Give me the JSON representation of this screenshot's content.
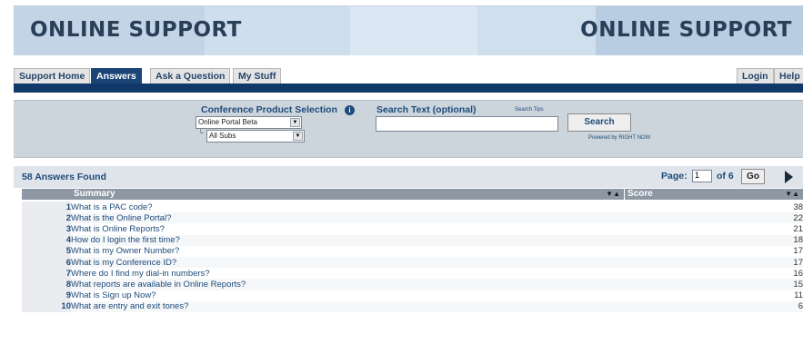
{
  "banner": {
    "title_left": "ONLINE SUPPORT",
    "title_right": "ONLINE SUPPORT"
  },
  "tabs": [
    {
      "label": "Support Home",
      "active": false
    },
    {
      "label": "Answers",
      "active": true
    },
    {
      "label": "Ask a Question",
      "active": false
    },
    {
      "label": "My Stuff",
      "active": false
    }
  ],
  "right_tabs": [
    {
      "label": "Login"
    },
    {
      "label": "Help"
    }
  ],
  "search": {
    "product_label": "Conference Product Selection",
    "product_value": "Online Portal Beta",
    "sub_value": "All Subs",
    "text_label": "Search Text (optional)",
    "tips_label": "Search Tips",
    "text_value": "",
    "button_label": "Search",
    "powered_by": "Powered by RIGHT NOW"
  },
  "results": {
    "found_label": "58 Answers Found",
    "page_label": "Page:",
    "page_value": "1",
    "page_of": "of 6",
    "go_label": "Go",
    "columns": {
      "summary": "Summary",
      "score": "Score"
    },
    "rows": [
      {
        "num": "1",
        "summary": "What is a PAC code?",
        "score": "38"
      },
      {
        "num": "2",
        "summary": "What is the Online Portal?",
        "score": "22"
      },
      {
        "num": "3",
        "summary": "What is Online Reports?",
        "score": "21"
      },
      {
        "num": "4",
        "summary": "How do I login the first time?",
        "score": "18"
      },
      {
        "num": "5",
        "summary": "What is my Owner Number?",
        "score": "17"
      },
      {
        "num": "6",
        "summary": "What is my Conference ID?",
        "score": "17"
      },
      {
        "num": "7",
        "summary": "Where do I find my dial-in numbers?",
        "score": "16"
      },
      {
        "num": "8",
        "summary": "What reports are available in Online Reports?",
        "score": "15"
      },
      {
        "num": "9",
        "summary": "What is Sign up Now?",
        "score": "11"
      },
      {
        "num": "10",
        "summary": "What are entry and exit tones?",
        "score": "6"
      }
    ]
  },
  "icons": {
    "info": "info-icon",
    "sort": "sort-arrows-icon",
    "next": "next-page-icon",
    "dropdown": "chevron-down-icon"
  }
}
